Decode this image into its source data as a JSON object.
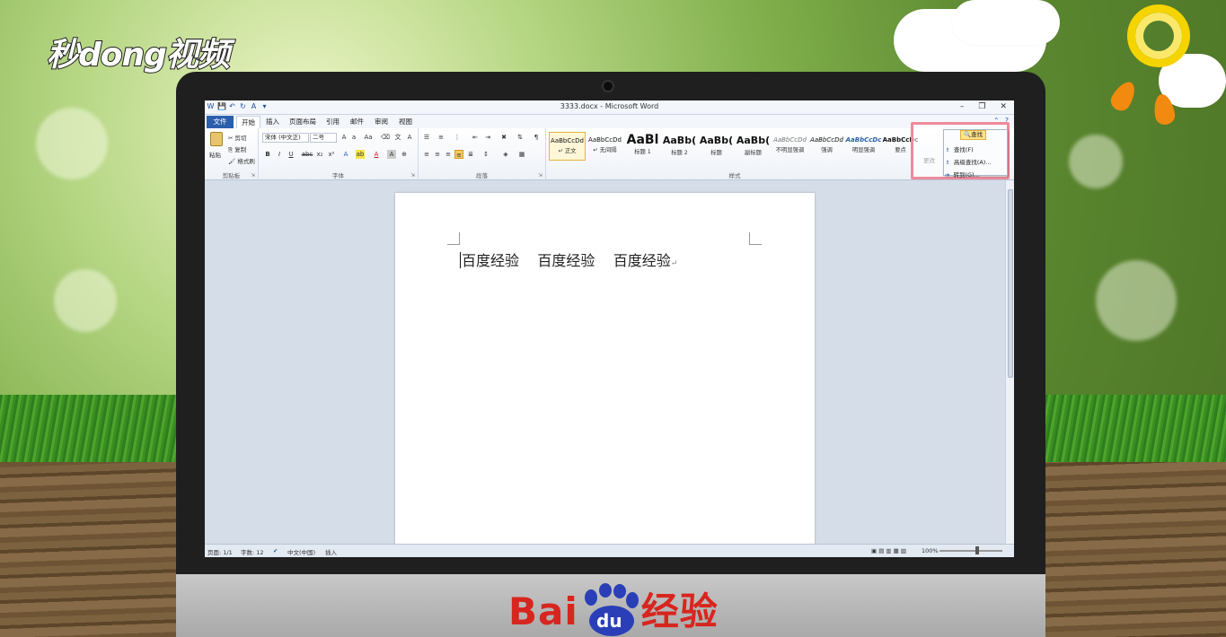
{
  "watermark": {
    "brand_text": "秒dong视频",
    "footer_brand": "Bai",
    "footer_du": "du",
    "footer_cn": "经验"
  },
  "window": {
    "title": "3333.docx - Microsoft Word",
    "quick_access": [
      "W",
      "💾",
      "↶",
      "↻",
      "A",
      "▾"
    ],
    "controls": [
      "–",
      "❐",
      "✕"
    ]
  },
  "tabs": {
    "file": "文件",
    "items": [
      "开始",
      "插入",
      "页面布局",
      "引用",
      "邮件",
      "审阅",
      "视图"
    ],
    "active": "开始"
  },
  "clipboard": {
    "paste": "粘贴",
    "cut": "剪切",
    "copy": "复制",
    "format_painter": "格式刷",
    "label": "剪贴板"
  },
  "font_group": {
    "font_name": "宋体 (中文正)",
    "font_size": "二号",
    "label": "字体",
    "row2": [
      "B",
      "I",
      "U",
      "abc",
      "x₂",
      "x²"
    ]
  },
  "paragraph_group": {
    "label": "段落"
  },
  "styles_group": {
    "label": "样式",
    "items": [
      {
        "sample": "AaBbCcDd",
        "name": "↵ 正文",
        "selected": true
      },
      {
        "sample": "AaBbCcDd",
        "name": "↵ 无间隔"
      },
      {
        "sample": "AaBl",
        "name": "标题 1"
      },
      {
        "sample": "AaBb(",
        "name": "标题 2"
      },
      {
        "sample": "AaBb(",
        "name": "标题"
      },
      {
        "sample": "AaBb(",
        "name": "副标题"
      },
      {
        "sample": "AaBbCcDd",
        "name": "不明显强调"
      },
      {
        "sample": "AaBbCcDd",
        "name": "强调"
      },
      {
        "sample": "AaBbCcDc",
        "name": "明显强调"
      },
      {
        "sample": "AaBbCcDc",
        "name": "要点"
      }
    ],
    "change_styles": "更改"
  },
  "find_menu": {
    "button": "查找",
    "items": [
      "查找(F)",
      "高级查找(A)...",
      "转到(G)..."
    ]
  },
  "document": {
    "text": "百度经验    百度经验    百度经验",
    "para_mark": "↵"
  },
  "statusbar": {
    "page": "页面: 1/1",
    "words": "字数: 12",
    "language": "中文(中国)",
    "mode": "插入",
    "zoom": "100%"
  }
}
